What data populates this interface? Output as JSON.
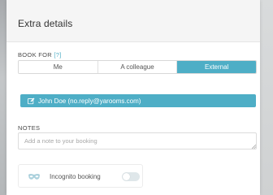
{
  "dialog": {
    "title": "Extra details"
  },
  "book_for": {
    "label": "BOOK FOR",
    "help_link": "[?]",
    "options": [
      "Me",
      "A colleague",
      "External"
    ],
    "selected": "External"
  },
  "person": {
    "display": "John Doe (no.reply@yarooms.com)",
    "icon": "edit-icon"
  },
  "notes": {
    "label": "NOTES",
    "placeholder": "Add a note to your booking",
    "value": ""
  },
  "incognito": {
    "label": "Incognito booking",
    "icon": "mask-icon",
    "enabled": false
  },
  "colors": {
    "accent": "#4eaec6",
    "header_bg": "#f5f5f5"
  }
}
